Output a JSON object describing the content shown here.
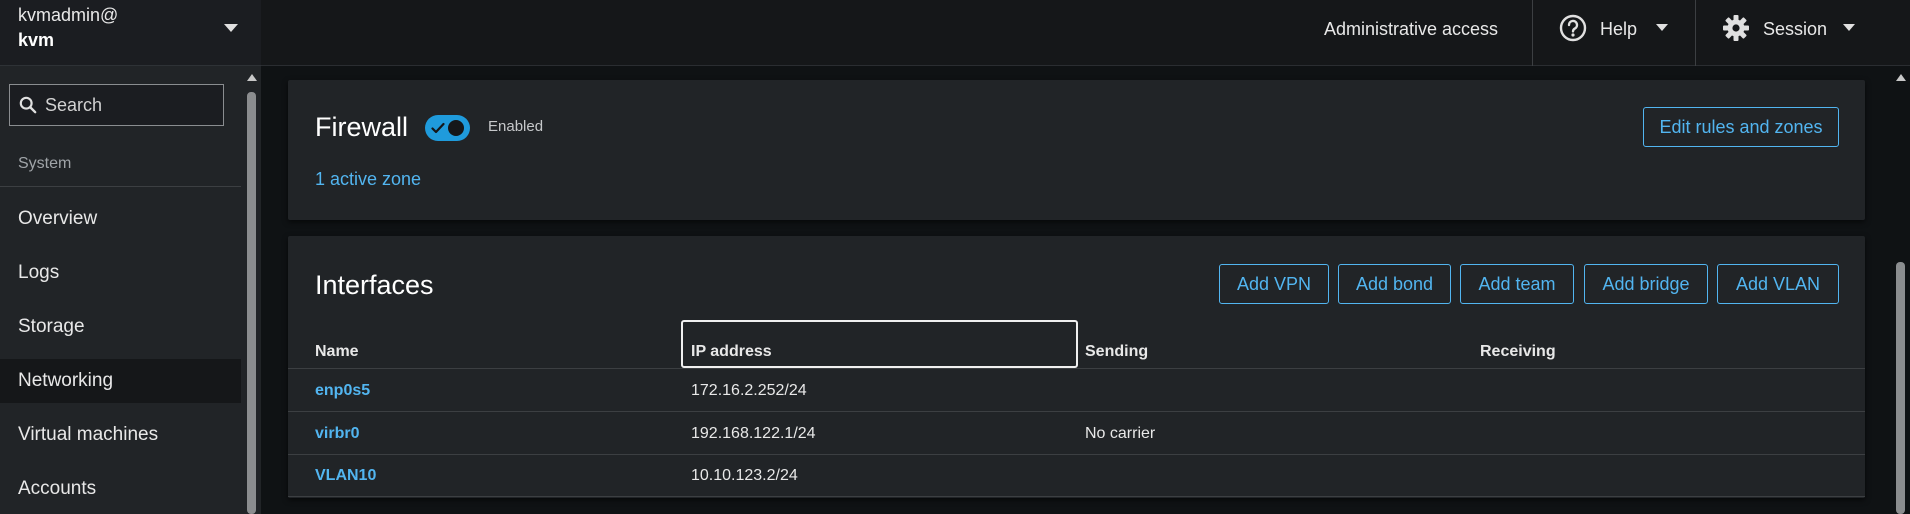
{
  "host": {
    "user": "kvmadmin@",
    "name": "kvm"
  },
  "search": {
    "placeholder": "Search",
    "value": ""
  },
  "sidebar": {
    "group_title": "System",
    "items": [
      {
        "label": "Overview",
        "active": false
      },
      {
        "label": "Logs",
        "active": false
      },
      {
        "label": "Storage",
        "active": false
      },
      {
        "label": "Networking",
        "active": true
      },
      {
        "label": "Virtual machines",
        "active": false
      },
      {
        "label": "Accounts",
        "active": false
      }
    ]
  },
  "topbar": {
    "admin_access": "Administrative access",
    "help_label": "Help",
    "session_label": "Session"
  },
  "firewall": {
    "title": "Firewall",
    "toggle_on": true,
    "status_label": "Enabled",
    "zones_link": "1 active zone",
    "edit_button": "Edit rules and zones"
  },
  "interfaces": {
    "title": "Interfaces",
    "buttons": [
      "Add VPN",
      "Add bond",
      "Add team",
      "Add bridge",
      "Add VLAN"
    ],
    "columns": [
      "Name",
      "IP address",
      "Sending",
      "Receiving"
    ],
    "rows": [
      {
        "name": "enp0s5",
        "ip": "172.16.2.252/24",
        "sending": "",
        "receiving": ""
      },
      {
        "name": "virbr0",
        "ip": "192.168.122.1/24",
        "sending": "No carrier",
        "receiving": ""
      },
      {
        "name": "VLAN10",
        "ip": "10.10.123.2/24",
        "sending": "",
        "receiving": ""
      }
    ]
  },
  "colors": {
    "accent": "#52b5f0",
    "toggle": "#1f9bdc",
    "sidebar_bg": "#212427",
    "page_bg": "#0f1214"
  }
}
